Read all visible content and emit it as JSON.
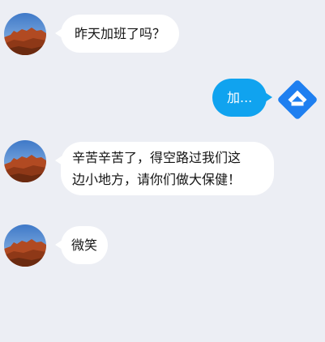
{
  "messages": [
    {
      "side": "left",
      "avatar": "desert-landscape-avatar",
      "lines": [
        "昨天加班了吗？"
      ]
    },
    {
      "side": "right",
      "avatar": "brand-logo-avatar",
      "lines": [
        "加..."
      ]
    },
    {
      "side": "left",
      "avatar": "desert-landscape-avatar",
      "lines": [
        "辛苦辛苦了，得空路过我们这",
        "边小地方，请你们做大保健！"
      ]
    },
    {
      "side": "left",
      "avatar": "desert-landscape-avatar",
      "lines": [
        "微笑"
      ]
    }
  ],
  "colors": {
    "background": "#eceef4",
    "incoming_bubble": "#ffffff",
    "outgoing_bubble": "#10a3ef",
    "logo_blue": "#1e7ff0"
  }
}
